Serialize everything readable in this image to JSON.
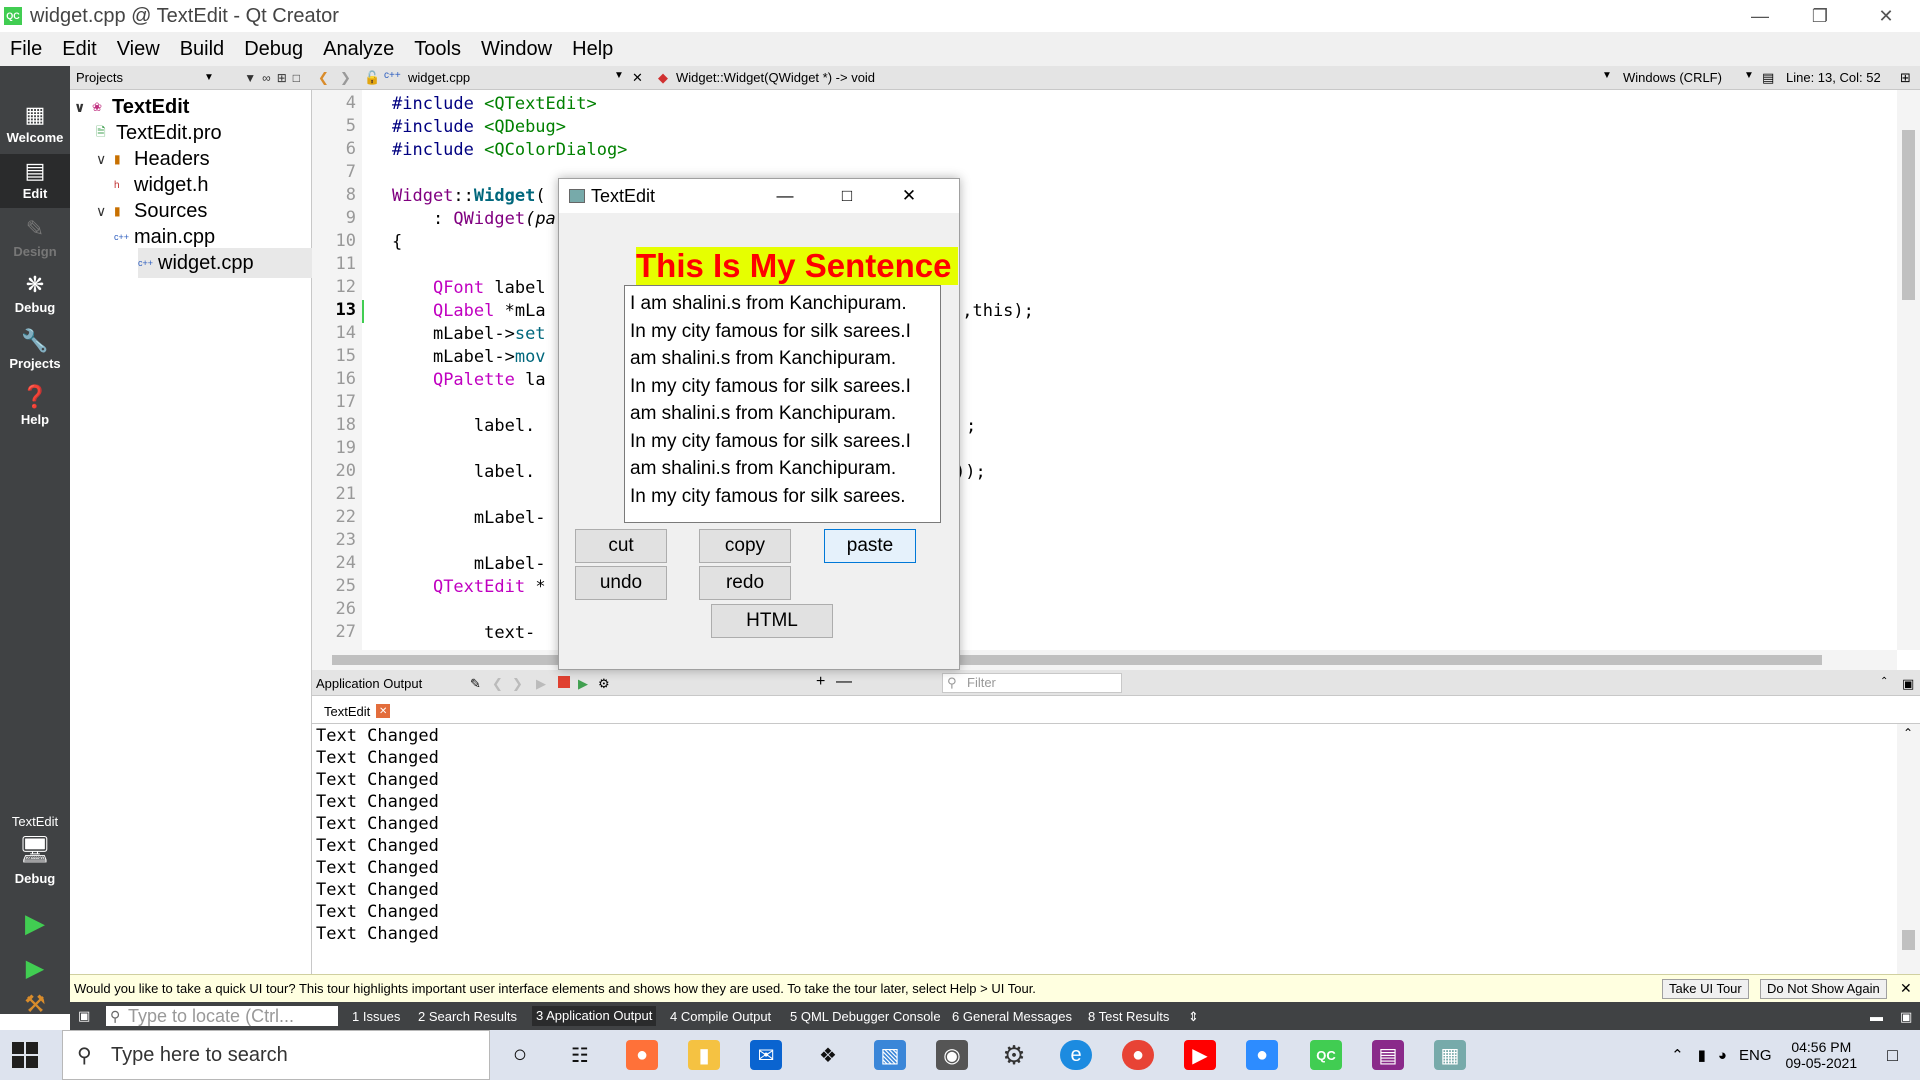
{
  "window": {
    "title": "widget.cpp @ TextEdit - Qt Creator",
    "logo": "QC"
  },
  "menu": [
    "File",
    "Edit",
    "View",
    "Build",
    "Debug",
    "Analyze",
    "Tools",
    "Window",
    "Help"
  ],
  "modes": [
    {
      "label": "Welcome",
      "icon": "grid-icon"
    },
    {
      "label": "Edit",
      "icon": "edit-icon"
    },
    {
      "label": "Design",
      "icon": "pencil-icon"
    },
    {
      "label": "Debug",
      "icon": "bug-icon"
    },
    {
      "label": "Projects",
      "icon": "wrench-icon"
    },
    {
      "label": "Help",
      "icon": "help-icon"
    }
  ],
  "kit": {
    "project": "TextEdit",
    "mode": "Debug"
  },
  "projects": {
    "header": "Projects",
    "tree": [
      {
        "label": "TextEdit",
        "bold": true
      },
      {
        "label": "TextEdit.pro"
      },
      {
        "label": "Headers"
      },
      {
        "label": "widget.h"
      },
      {
        "label": "Sources"
      },
      {
        "label": "main.cpp"
      },
      {
        "label": "widget.cpp",
        "selected": true
      }
    ]
  },
  "editor": {
    "file": "widget.cpp",
    "symbol": "Widget::Widget(QWidget *) -> void",
    "line_ending": "Windows (CRLF)",
    "position": "Line: 13, Col: 52",
    "current_line": "13",
    "line_numbers": [
      "4",
      "5",
      "6",
      "7",
      "8",
      "9",
      "10",
      "11",
      "12",
      "13",
      "14",
      "15",
      "16",
      "17",
      "18",
      "19",
      "20",
      "21",
      "22",
      "23",
      "24",
      "25",
      "26",
      "27"
    ],
    "lines": {
      "l4a": "#include ",
      "l4b": "<QTextEdit>",
      "l5a": "#include ",
      "l5b": "<QDebug>",
      "l6a": "#include ",
      "l6b": "<QColorDialog>",
      "l8a": "Widget",
      "l8b": "::",
      "l8c": "Widget",
      "l8d": "(",
      "l9a": "    : ",
      "l9b": "QWidget",
      "l9c": "(pa",
      "l10": "{",
      "l12a": "    ",
      "l12b": "QFont",
      "l12c": " label",
      "l13a": "    ",
      "l13b": "QLabel",
      "l13c": " *mLa",
      "l13d": "\",this);",
      "l14a": "    mLabel->",
      "l14b": "set",
      "l15a": "    mLabel->",
      "l15b": "mov",
      "l16a": "    ",
      "l16b": "QPalette",
      "l16c": " la",
      "l18a": "        label.",
      "l18b": ";",
      "l20a": "        label.",
      "l20b": "));",
      "l22": "        mLabel-",
      "l24": "        mLabel-",
      "l25a": "    ",
      "l25b": "QTextEdit",
      "l25c": " *",
      "l27": "         text-"
    }
  },
  "app_dialog": {
    "title": "TextEdit",
    "label": "This Is My Sentence",
    "text_lines": [
      "I am shalini.s from Kanchipuram.",
      "In my city famous for silk sarees.I",
      "am shalini.s from Kanchipuram.",
      "In my city famous for silk sarees.I",
      "am shalini.s from Kanchipuram.",
      "In my city famous for silk sarees.I",
      "am shalini.s from Kanchipuram.",
      "In my city famous for silk sarees."
    ],
    "buttons": {
      "cut": "cut",
      "copy": "copy",
      "paste": "paste",
      "undo": "undo",
      "redo": "redo",
      "html": "HTML"
    }
  },
  "output": {
    "header": "Application Output",
    "filter_placeholder": "Filter",
    "tab": "TextEdit",
    "lines": [
      "Text Changed",
      "Text Changed",
      "Text Changed",
      "Text Changed",
      "Text Changed",
      "Text Changed",
      "Text Changed",
      "Text Changed",
      "Text Changed",
      "Text Changed"
    ]
  },
  "tour": {
    "message": "Would you like to take a quick UI tour? This tour highlights important user interface elements and shows how they are used. To take the tour later, select Help > UI Tour.",
    "take": "Take UI Tour",
    "dismiss": "Do Not Show Again"
  },
  "statusbar": {
    "locate_placeholder": "Type to locate (Ctrl...",
    "tabs": [
      "1  Issues",
      "2  Search Results",
      "3  Application Output",
      "4  Compile Output",
      "5  QML Debugger Console",
      "6  General Messages",
      "8  Test Results"
    ]
  },
  "taskbar": {
    "search_placeholder": "Type here to search",
    "lang": "ENG",
    "time": "04:56 PM",
    "date": "09-05-2021"
  }
}
